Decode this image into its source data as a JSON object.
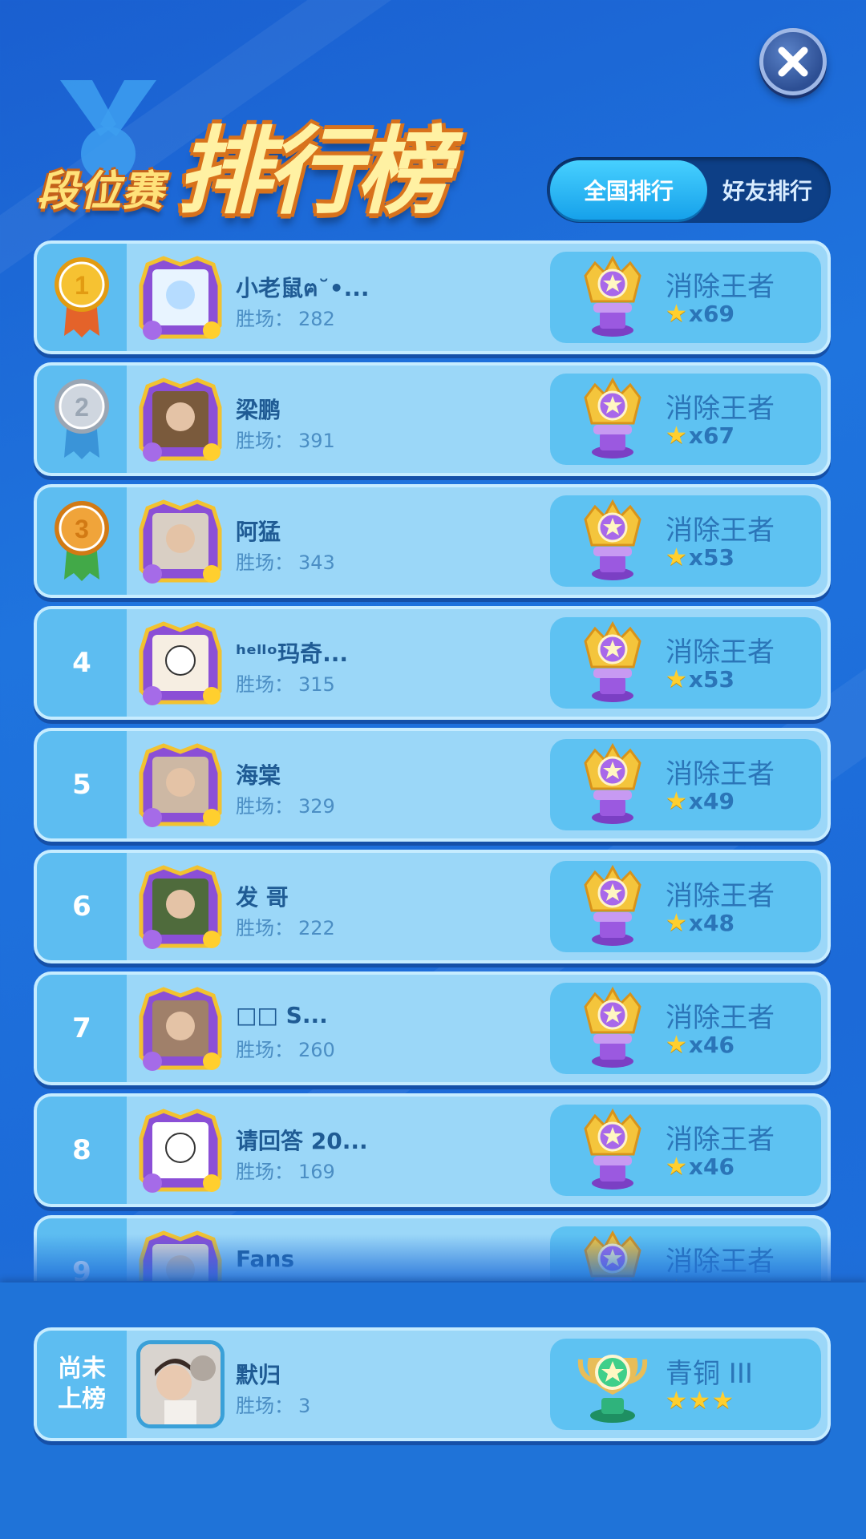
{
  "header": {
    "title_small": "段位赛",
    "title_big": "排行榜",
    "tabs": [
      {
        "label": "全国排行",
        "active": true
      },
      {
        "label": "好友排行",
        "active": false
      }
    ]
  },
  "wins_label": "胜场：",
  "players": [
    {
      "rank": "1",
      "name": "小老鼠ฅ˘•...",
      "wins": "282",
      "tier": "消除王者",
      "stars": "x69",
      "medal": "gold"
    },
    {
      "rank": "2",
      "name": "梁鹏",
      "wins": "391",
      "tier": "消除王者",
      "stars": "x67",
      "medal": "silver"
    },
    {
      "rank": "3",
      "name": "阿猛",
      "wins": "343",
      "tier": "消除王者",
      "stars": "x53",
      "medal": "bronze"
    },
    {
      "rank": "4",
      "name": "ʰᵉˡˡᵒ玛奇...",
      "wins": "315",
      "tier": "消除王者",
      "stars": "x53"
    },
    {
      "rank": "5",
      "name": "海棠",
      "wins": "329",
      "tier": "消除王者",
      "stars": "x49"
    },
    {
      "rank": "6",
      "name": "发 哥",
      "wins": "222",
      "tier": "消除王者",
      "stars": "x48"
    },
    {
      "rank": "7",
      "name": "□□  S...",
      "wins": "260",
      "tier": "消除王者",
      "stars": "x46"
    },
    {
      "rank": "8",
      "name": "请回答 20...",
      "wins": "169",
      "tier": "消除王者",
      "stars": "x46"
    },
    {
      "rank": "9",
      "name": "Fans",
      "wins": "",
      "tier": "消除王者",
      "stars": ""
    }
  ],
  "self": {
    "rank_text": "尚未\n上榜",
    "name": "默归",
    "wins": "3",
    "tier": "青铜 III",
    "star_count": 3
  },
  "colors": {
    "gold": "#f6c232",
    "silver": "#cfd6df",
    "bronze": "#f0a43a"
  }
}
